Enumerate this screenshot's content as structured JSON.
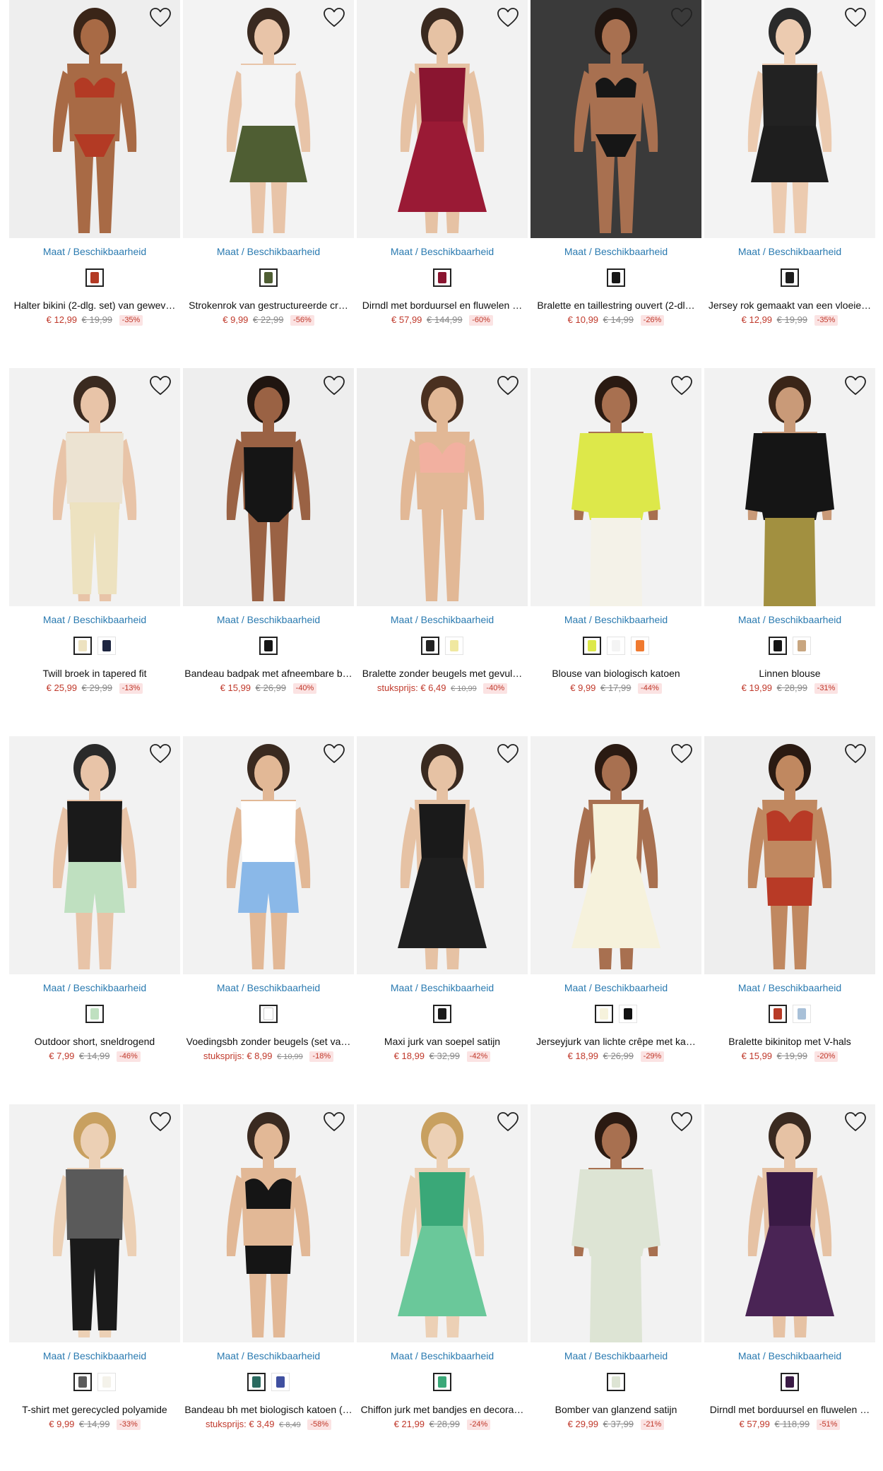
{
  "colors": {
    "accent_blue": "#2a7ab0",
    "sale_red": "#c0392b",
    "old_price_grey": "#8a8a8a",
    "discount_bg": "#fbe3e3"
  },
  "icons": {
    "wishlist": "heart-outline-icon"
  },
  "maat_label": "Maat / Beschikbaarheid",
  "products": [
    {
      "name": "Halter bikini (2-dlg. set) van gewev…",
      "price": "€ 12,99",
      "old_price": "€ 19,99",
      "discount": "-35%",
      "bg": "#eeeeee",
      "skin": "#a86a45",
      "hair": "#3a2518",
      "top": "#b33a24",
      "bottom": "#b33a24",
      "style": "bikini",
      "swatches": [
        "#b33a24"
      ]
    },
    {
      "name": "Strokenrok van gestructureerde cr…",
      "price": "€ 9,99",
      "old_price": "€ 22,99",
      "discount": "-56%",
      "bg": "#f3f3f3",
      "skin": "#e8c4a8",
      "hair": "#3a2a20",
      "top": "#f4f4f4",
      "bottom": "#4f5e33",
      "style": "skirt",
      "swatches": [
        "#4f5e33"
      ]
    },
    {
      "name": "Dirndl met borduursel en fluwelen …",
      "price": "€ 57,99",
      "old_price": "€ 144,99",
      "discount": "-60%",
      "bg": "#f2f2f2",
      "skin": "#e6c2a4",
      "hair": "#3a2a20",
      "top": "#8a1530",
      "bottom": "#9a1a35",
      "style": "dress",
      "swatches": [
        "#8a1530"
      ]
    },
    {
      "name": "Bralette en taillestring ouvert (2-dl…",
      "price": "€ 10,99",
      "old_price": "€ 14,99",
      "discount": "-26%",
      "bg": "#3a3a3a",
      "skin": "#a87050",
      "hair": "#201510",
      "top": "#161616",
      "bottom": "#161616",
      "style": "bikini",
      "swatches": [
        "#161616"
      ]
    },
    {
      "name": "Jersey rok gemaakt van een vloeie…",
      "price": "€ 12,99",
      "old_price": "€ 19,99",
      "discount": "-35%",
      "bg": "#f3f3f3",
      "skin": "#eccbb0",
      "hair": "#2a2a2a",
      "top": "#222222",
      "bottom": "#1e1e1e",
      "style": "skirt",
      "swatches": [
        "#1e1e1e"
      ]
    },
    {
      "name": "Twill broek in tapered fit",
      "price": "€ 25,99",
      "old_price": "€ 29,99",
      "discount": "-13%",
      "bg": "#f2f2f2",
      "skin": "#e8c4a8",
      "hair": "#3a2a20",
      "top": "#ece3d2",
      "bottom": "#ede2c0",
      "style": "pants",
      "swatches": [
        "#ede2c0",
        "#1d2540"
      ]
    },
    {
      "name": "Bandeau badpak met afneembare b…",
      "price": "€ 15,99",
      "old_price": "€ 26,99",
      "discount": "-40%",
      "bg": "#eeeeee",
      "skin": "#9a6244",
      "hair": "#201510",
      "top": "#151515",
      "bottom": "#151515",
      "style": "swim",
      "swatches": [
        "#151515"
      ]
    },
    {
      "name": "Bralette zonder beugels met gevul…",
      "label": "stuksprijs:",
      "price": "€ 6,49",
      "old_price": "€ 10,99",
      "old_small": true,
      "discount": "-40%",
      "bg": "#efefef",
      "skin": "#e2b896",
      "hair": "#4a3020",
      "top": "#f2b0a0",
      "bottom": "#efefef",
      "style": "bralette",
      "swatches": [
        "#222222",
        "#f0e8a0"
      ]
    },
    {
      "name": "Blouse van biologisch katoen",
      "price": "€ 9,99",
      "old_price": "€ 17,99",
      "discount": "-44%",
      "bg": "#f2f2f2",
      "skin": "#a87050",
      "hair": "#2a1a12",
      "top": "#dde84a",
      "bottom": "#f4f2e8",
      "style": "blouse",
      "swatches": [
        "#dde84a",
        "#f4f4f4",
        "#f07a30"
      ]
    },
    {
      "name": "Linnen blouse",
      "price": "€ 19,99",
      "old_price": "€ 28,99",
      "discount": "-31%",
      "bg": "#f2f2f2",
      "skin": "#c99a78",
      "hair": "#3a2518",
      "top": "#151515",
      "bottom": "#a29040",
      "style": "blouse",
      "swatches": [
        "#151515",
        "#c8a680"
      ]
    },
    {
      "name": "Outdoor short, sneldrogend",
      "price": "€ 7,99",
      "old_price": "€ 14,99",
      "discount": "-46%",
      "bg": "#f2f2f2",
      "skin": "#e8c4a8",
      "hair": "#2a2a2a",
      "top": "#1a1a1a",
      "bottom": "#bfe0c0",
      "style": "shorts",
      "swatches": [
        "#bfe0c0"
      ]
    },
    {
      "name": "Voedingsbh zonder beugels (set va…",
      "label": "stuksprijs:",
      "price": "€ 8,99",
      "old_price": "€ 10,99",
      "old_small": true,
      "discount": "-18%",
      "bg": "#f2f2f2",
      "skin": "#e2b896",
      "hair": "#3a2a20",
      "top": "#ffffff",
      "bottom": "#8ab8e8",
      "style": "shorts",
      "swatches": [
        "#ffffff"
      ]
    },
    {
      "name": "Maxi jurk van soepel satijn",
      "price": "€ 18,99",
      "old_price": "€ 32,99",
      "discount": "-42%",
      "bg": "#f2f2f2",
      "skin": "#e6c2a4",
      "hair": "#3a2a20",
      "top": "#1a1a1a",
      "bottom": "#1f1f1f",
      "style": "dress",
      "swatches": [
        "#1a1a1a"
      ]
    },
    {
      "name": "Jerseyjurk van lichte crêpe met ka…",
      "price": "€ 18,99",
      "old_price": "€ 26,99",
      "discount": "-29%",
      "bg": "#f2f2f2",
      "skin": "#a87050",
      "hair": "#2a1a12",
      "top": "#f6f2dc",
      "bottom": "#f6f2dc",
      "style": "dress",
      "swatches": [
        "#f6f2dc",
        "#111111"
      ]
    },
    {
      "name": "Bralette bikinitop met V-hals",
      "price": "€ 15,99",
      "old_price": "€ 19,99",
      "discount": "-20%",
      "bg": "#eeeeee",
      "skin": "#c08860",
      "hair": "#2a1a12",
      "top": "#b83a26",
      "bottom": "#b83a26",
      "style": "bralette",
      "swatches": [
        "#b83a26",
        "#a8c0d8"
      ]
    },
    {
      "name": "T-shirt met gerecycled polyamide",
      "price": "€ 9,99",
      "old_price": "€ 14,99",
      "discount": "-33%",
      "bg": "#f2f2f2",
      "skin": "#ecd0b5",
      "hair": "#c8a060",
      "top": "#5a5a5a",
      "bottom": "#1a1a1a",
      "style": "pants",
      "swatches": [
        "#5a5a5a",
        "#f4f2ea"
      ]
    },
    {
      "name": "Bandeau bh met biologisch katoen (…",
      "label": "stuksprijs:",
      "price": "€ 3,49",
      "old_price": "€ 8,49",
      "old_small": true,
      "discount": "-58%",
      "bg": "#f2f2f2",
      "skin": "#e2b896",
      "hair": "#3a2a20",
      "top": "#151515",
      "bottom": "#151515",
      "style": "bralette",
      "swatches": [
        "#2a6a60",
        "#4050a0"
      ]
    },
    {
      "name": "Chiffon jurk met bandjes en decora…",
      "price": "€ 21,99",
      "old_price": "€ 28,99",
      "discount": "-24%",
      "bg": "#f2f2f2",
      "skin": "#ecd0b5",
      "hair": "#c8a060",
      "top": "#3aa878",
      "bottom": "#6ac89a",
      "style": "dress",
      "swatches": [
        "#3aa878"
      ]
    },
    {
      "name": "Bomber van glanzend satijn",
      "price": "€ 29,99",
      "old_price": "€ 37,99",
      "discount": "-21%",
      "bg": "#f2f2f2",
      "skin": "#a87050",
      "hair": "#2a1a12",
      "top": "#dde4d4",
      "bottom": "#dde4d4",
      "style": "blouse",
      "swatches": [
        "#dde4d4"
      ]
    },
    {
      "name": "Dirndl met borduursel en fluwelen …",
      "price": "€ 57,99",
      "old_price": "€ 118,99",
      "discount": "-51%",
      "bg": "#f2f2f2",
      "skin": "#e6c2a4",
      "hair": "#3a2a20",
      "top": "#3a1a45",
      "bottom": "#4a2455",
      "style": "dress",
      "swatches": [
        "#3a1a45"
      ]
    }
  ]
}
